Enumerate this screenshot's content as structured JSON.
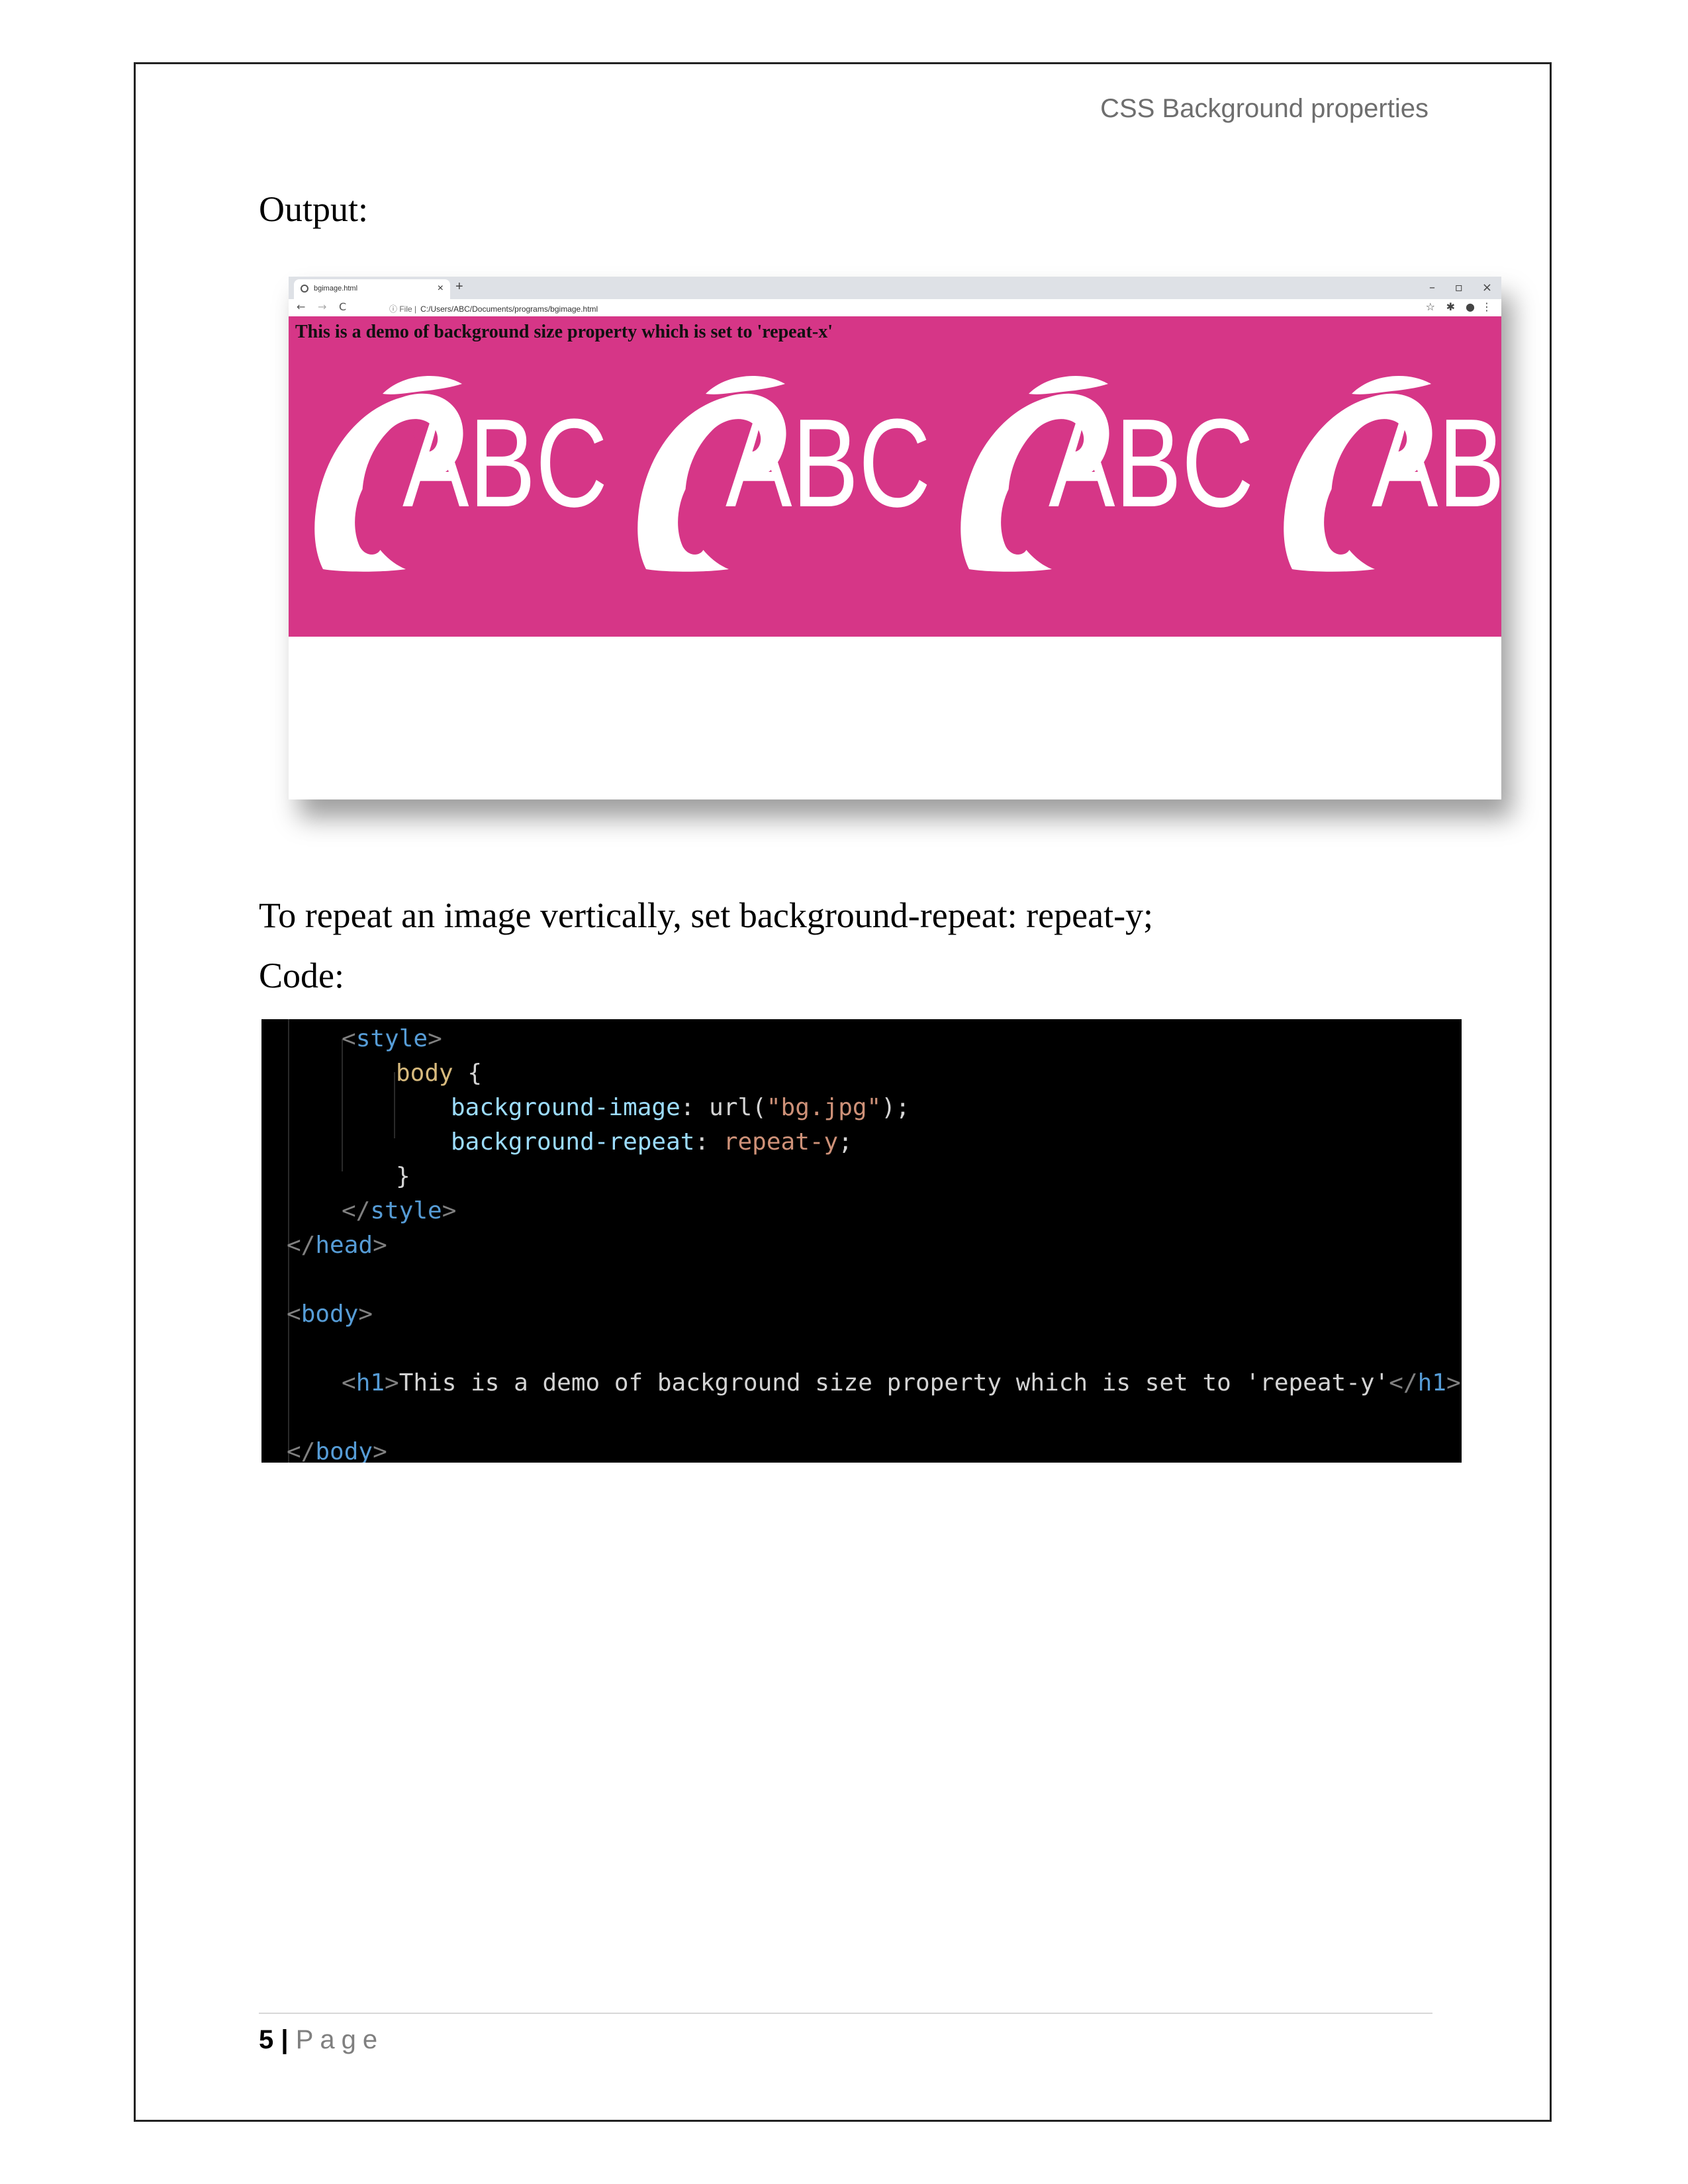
{
  "header": {
    "title": "CSS Background properties"
  },
  "sections": {
    "output_label": "Output:",
    "repeat_y_text": "To repeat an image vertically, set background-repeat: repeat-y;",
    "code_label": "Code:"
  },
  "browser": {
    "tab_title": "bgimage.html",
    "tab_close": "×",
    "new_tab": "+",
    "win_minimize": "–",
    "win_restore": "▫",
    "win_close": "×",
    "nav_back": "←",
    "nav_forward": "→",
    "nav_reload": "C",
    "url_info": "ⓘ File |",
    "url": "C:/Users/ABC/Documents/programs/bgimage.html",
    "star": "☆",
    "pin": "✱",
    "profile": "●",
    "menu": "⋮",
    "page_heading": "This is a demo of background size property which is set to 'repeat-x'",
    "background_color": "#d63687",
    "logo_text": "ABC"
  },
  "code": {
    "line1": {
      "open": "<",
      "name": "style",
      "close": ">"
    },
    "line2": {
      "selector": "body",
      "brace": " {"
    },
    "line3": {
      "prop": "background-image",
      "colon": ": ",
      "fn": "url(",
      "str": "\"bg.jpg\"",
      "end": ");"
    },
    "line4": {
      "prop": "background-repeat",
      "colon": ": ",
      "value": "repeat-y",
      "end": ";"
    },
    "line5": {
      "brace": "}"
    },
    "line6": {
      "open": "</",
      "name": "style",
      "close": ">"
    },
    "line7": {
      "open": "</",
      "name": "head",
      "close": ">"
    },
    "line8": {
      "open": "<",
      "name": "body",
      "close": ">"
    },
    "line9": {
      "open": "<",
      "name": "h1",
      "close": ">",
      "text": "This is a demo of background size property which is set to 'repeat-y'",
      "open2": "</",
      "name2": "h1",
      "close2": ">"
    },
    "line10": {
      "open": "</",
      "name": "body",
      "close": ">"
    }
  },
  "footer": {
    "page_number": "5",
    "separator": "|",
    "page_label": "Page"
  }
}
